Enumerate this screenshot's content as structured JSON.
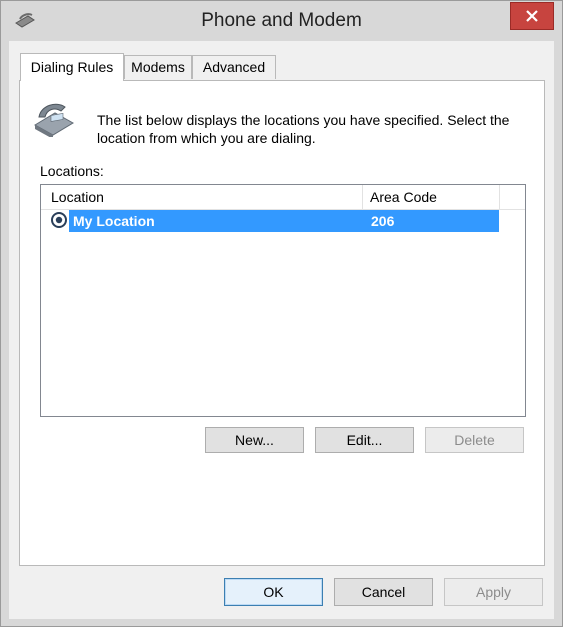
{
  "window": {
    "title": "Phone and Modem"
  },
  "tabs": [
    {
      "label": "Dialing Rules",
      "active": true
    },
    {
      "label": "Modems",
      "active": false
    },
    {
      "label": "Advanced",
      "active": false
    }
  ],
  "dialing_rules": {
    "description": "The list below displays the locations you have specified. Select the location from which you are dialing.",
    "locations_label": "Locations:",
    "columns": [
      "Location",
      "Area Code"
    ],
    "rows": [
      {
        "location": "My Location",
        "area_code": "206",
        "selected": true
      }
    ],
    "buttons": {
      "new": "New...",
      "edit": "Edit...",
      "delete": "Delete"
    }
  },
  "footer": {
    "ok": "OK",
    "cancel": "Cancel",
    "apply": "Apply"
  },
  "colors": {
    "selection": "#3399ff",
    "close_button": "#c7443f",
    "chrome": "#d8d8d8"
  },
  "icons": [
    "phone-modem-app-icon",
    "close-icon",
    "telephone-icon",
    "radio-selected-icon"
  ]
}
